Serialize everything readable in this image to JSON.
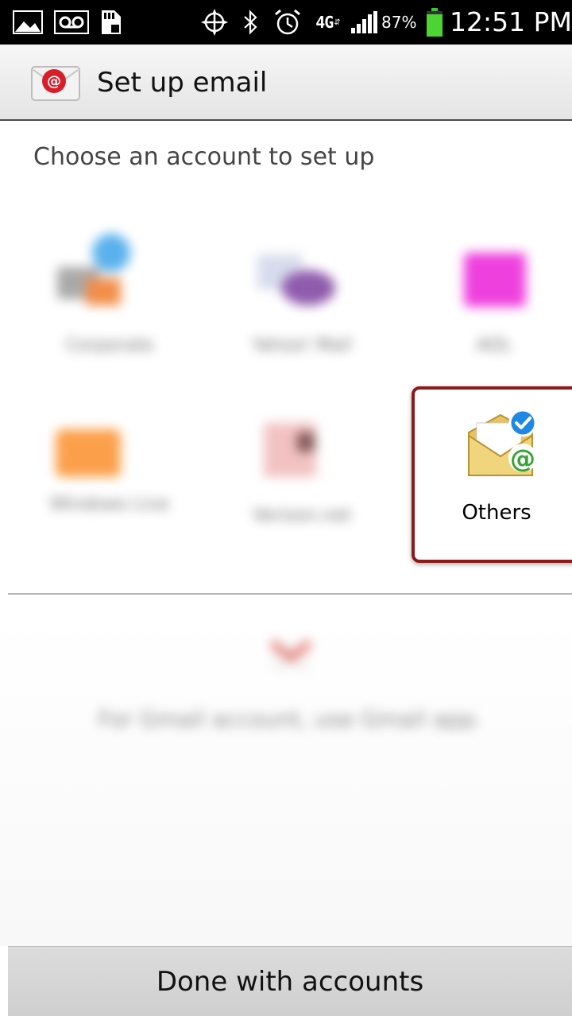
{
  "status_bar": {
    "battery_percent": "87%",
    "time": "12:51 PM",
    "network": "4G",
    "battery_level": 0.87
  },
  "action_bar": {
    "title": "Set up email"
  },
  "main": {
    "heading": "Choose an account to set up",
    "accounts": [
      {
        "label": "Corporate"
      },
      {
        "label": "Yahoo! Mail"
      },
      {
        "label": "AOL"
      },
      {
        "label": "Windows Live"
      },
      {
        "label": "Verizon.net"
      },
      {
        "label": "Others"
      }
    ],
    "gmail_note": "For Gmail account, use Gmail app."
  },
  "footer": {
    "done_label": "Done with accounts"
  }
}
